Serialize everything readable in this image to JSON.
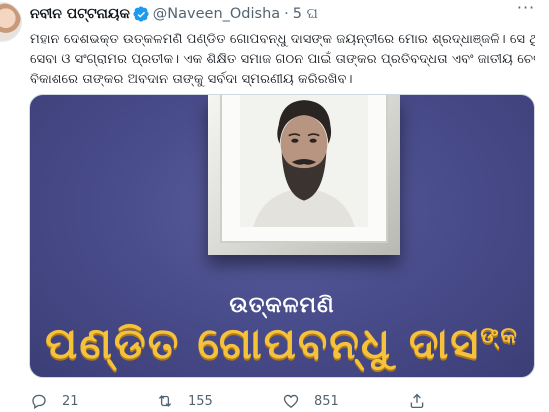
{
  "tweet": {
    "display_name": "ନବୀନ ପଟ୍ଟନାୟକ",
    "handle": "@Naveen_Odisha",
    "separator": "·",
    "time": "5 ଘ",
    "more_label": "···",
    "text_lines": [
      "ମହାନ ଦେଶଭକ୍ତ ଉତ୍କଳମଣି ପଣ୍ଡିତ ଗୋପବନ୍ଧୁ ଦାସଙ୍କ ଜୟନ୍ତୀରେ ମୋର ଶ୍ରଦ୍ଧାଞ୍ଜଳି। ସେ ଥିଲେ ତ୍ୟାଗ,",
      "ସେବା ଓ ସଂଗ୍ରାମର ପ୍ରତୀକ। ଏକ ଶିକ୍ଷିତ ସମାଜ ଗଠନ ପାଇଁ ତାଙ୍କର ପ୍ରତିବଦ୍ଧତା ଏବଂ ଜାତୀୟ ଚେତନାର",
      "ବିକାଶରେ ତାଙ୍କର ଅବଦାନ ତାଙ୍କୁ ସର୍ବଦା ସ୍ମରଣୀୟ କରିରଖିବ।"
    ],
    "media": {
      "subtitle": "ଉତ୍କଳମଣି",
      "title": "ପଣ୍ଡିତ ଗୋପବନ୍ଧୁ ଦାସ",
      "title_suffix": "ଙ୍କ"
    },
    "actions": {
      "reply_count": "21",
      "retweet_count": "155",
      "like_count": "851"
    },
    "colors": {
      "verified": "#1d9bf0",
      "media_bg": "#4a4d8c",
      "title": "#f6c23c"
    }
  }
}
